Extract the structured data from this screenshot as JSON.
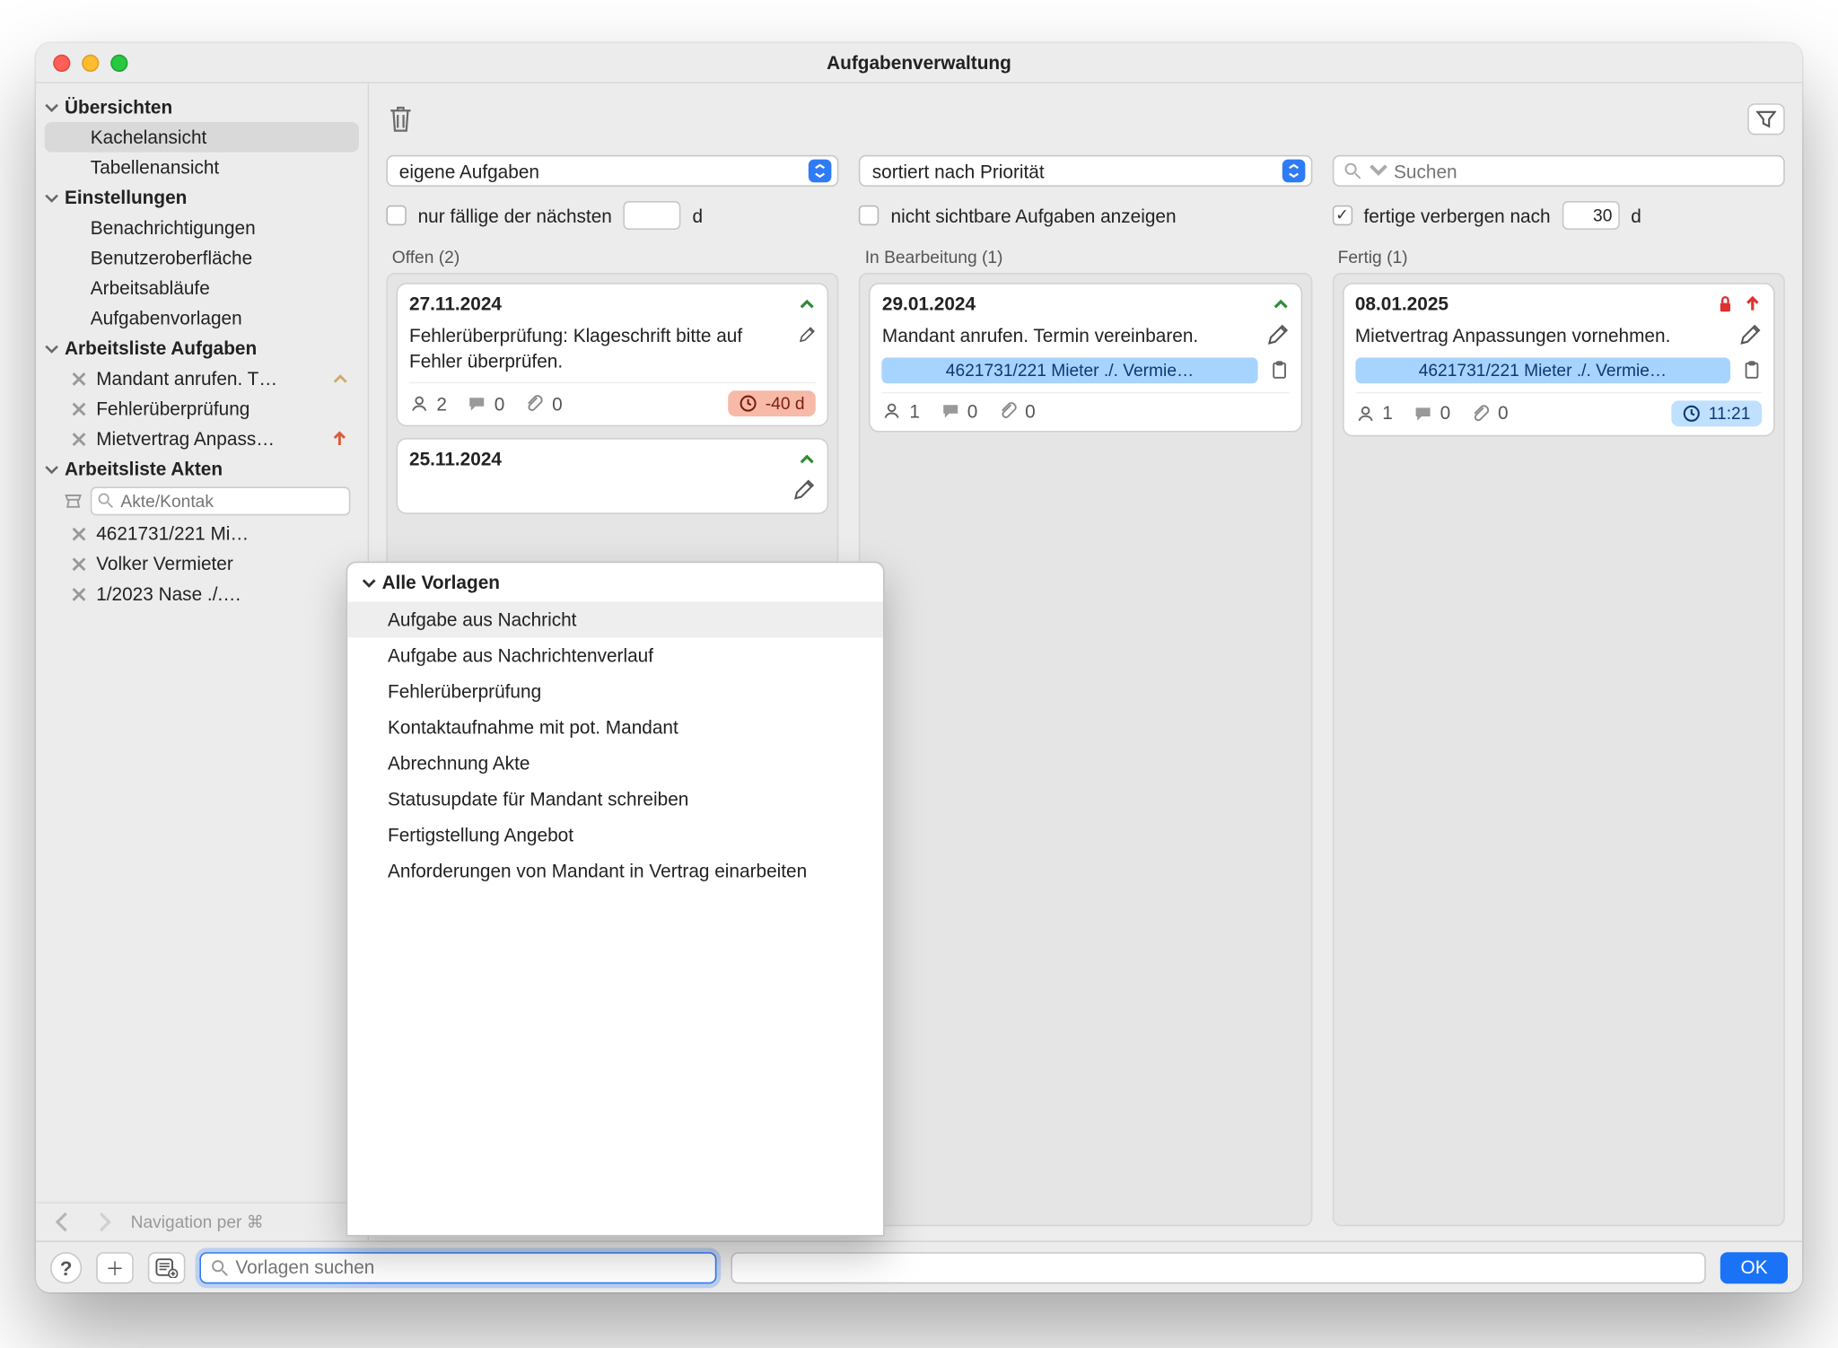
{
  "window": {
    "title": "Aufgabenverwaltung"
  },
  "sidebar": {
    "groups": [
      {
        "label": "Übersichten",
        "items": [
          {
            "label": "Kachelansicht",
            "selected": true
          },
          {
            "label": "Tabellenansicht"
          }
        ]
      },
      {
        "label": "Einstellungen",
        "items": [
          {
            "label": "Benachrichtigungen"
          },
          {
            "label": "Benutzeroberfläche"
          },
          {
            "label": "Arbeitsabläufe"
          },
          {
            "label": "Aufgabenvorlagen"
          }
        ]
      },
      {
        "label": "Arbeitsliste Aufgaben",
        "items": [
          {
            "label": "Mandant anrufen. T…",
            "x": true,
            "chev": true
          },
          {
            "label": "Fehlerüberprüfung",
            "x": true
          },
          {
            "label": "Mietvertrag Anpass…",
            "x": true,
            "up": true
          }
        ]
      },
      {
        "label": "Arbeitsliste Akten",
        "search_placeholder": "Akte/Kontak",
        "items": [
          {
            "label": "4621731/221 Mi…",
            "x": true
          },
          {
            "label": "Volker Vermieter",
            "x": true
          },
          {
            "label": "1/2023 Nase ./.…",
            "x": true
          }
        ]
      }
    ],
    "nav_hint": "Navigation per ⌘"
  },
  "toolbar": {
    "filter_select": "eigene Aufgaben",
    "sort_select": "sortiert nach Priorität",
    "search_placeholder": "Suchen"
  },
  "options": {
    "only_due_label": "nur fällige der nächsten",
    "only_due_value": "",
    "only_due_unit": "d",
    "show_hidden_label": "nicht sichtbare Aufgaben anzeigen",
    "hide_done_label": "fertige verbergen nach",
    "hide_done_value": "30",
    "hide_done_unit": "d"
  },
  "columns": [
    {
      "title": "Offen (2)",
      "cards": [
        {
          "date": "27.11.2024",
          "text": "Fehlerüberprüfung: Klageschrift bitte auf Fehler überprüfen.",
          "assignees": "2",
          "comments": "0",
          "attachments": "0",
          "pill": {
            "kind": "red",
            "text": "-40 d"
          }
        },
        {
          "date": "25.11.2024",
          "text": "",
          "partial": true
        }
      ]
    },
    {
      "title": "In Bearbeitung (1)",
      "cards": [
        {
          "date": "29.01.2024",
          "text": "Mandant anrufen. Termin vereinbaren.",
          "tag": "4621731/221 Mieter ./. Vermie…",
          "assignees": "1",
          "comments": "0",
          "attachments": "0"
        }
      ]
    },
    {
      "title": "Fertig (1)",
      "cards": [
        {
          "date": "08.01.2025",
          "text": "Mietvertrag Anpassungen vornehmen.",
          "locked": true,
          "upred": true,
          "tag": "4621731/221 Mieter ./. Vermie…",
          "assignees": "1",
          "comments": "0",
          "attachments": "0",
          "pill": {
            "kind": "blue",
            "text": "11:21"
          }
        }
      ]
    }
  ],
  "popup": {
    "header": "Alle Vorlagen",
    "items": [
      "Aufgabe aus Nachricht",
      "Aufgabe aus Nachrichtenverlauf",
      "Fehlerüberprüfung",
      "Kontaktaufnahme mit pot. Mandant",
      "Abrechnung Akte",
      "Statusupdate für Mandant schreiben",
      "Fertigstellung Angebot",
      "Anforderungen von Mandant in Vertrag einarbeiten"
    ],
    "selected_index": 0
  },
  "bottom": {
    "search_placeholder": "Vorlagen suchen",
    "ok": "OK"
  }
}
